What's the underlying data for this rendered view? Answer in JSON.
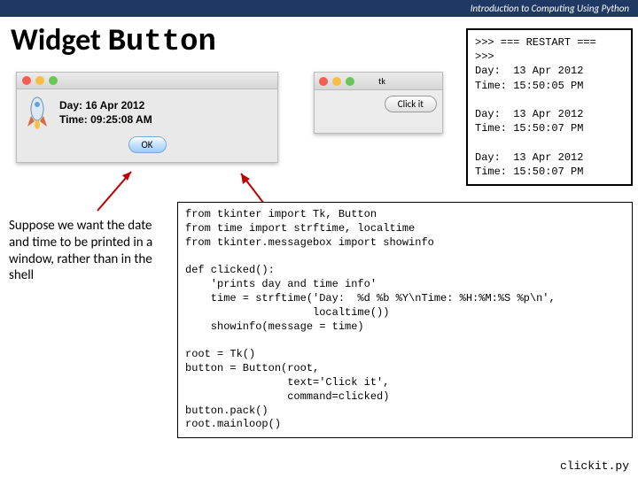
{
  "header": "Introduction to Computing Using Python",
  "title": {
    "plain": "Widget ",
    "mono": "Button"
  },
  "shell": ">>> === RESTART ===\n>>>\nDay:  13 Apr 2012\nTime: 15:50:05 PM\n\nDay:  13 Apr 2012\nTime: 15:50:07 PM\n\nDay:  13 Apr 2012\nTime: 15:50:07 PM",
  "msgbox": {
    "line1": "Day: 16 Apr 2012",
    "line2": "Time: 09:25:08 AM",
    "ok": "OK"
  },
  "tkwin": {
    "title": "tk",
    "button": "Click it"
  },
  "caption": "Suppose we want the date and time to be printed in a window, rather than in the shell",
  "code": "from tkinter import Tk, Button\nfrom time import strftime, localtime\nfrom tkinter.messagebox import showinfo\n\ndef clicked():\n    'prints day and time info'\n    time = strftime('Day:  %d %b %Y\\nTime: %H:%M:%S %p\\n',\n                    localtime())\n    showinfo(message = time)\n\nroot = Tk()\nbutton = Button(root,\n                text='Click it',\n                command=clicked)\nbutton.pack()\nroot.mainloop()",
  "filename": "clickit.py"
}
